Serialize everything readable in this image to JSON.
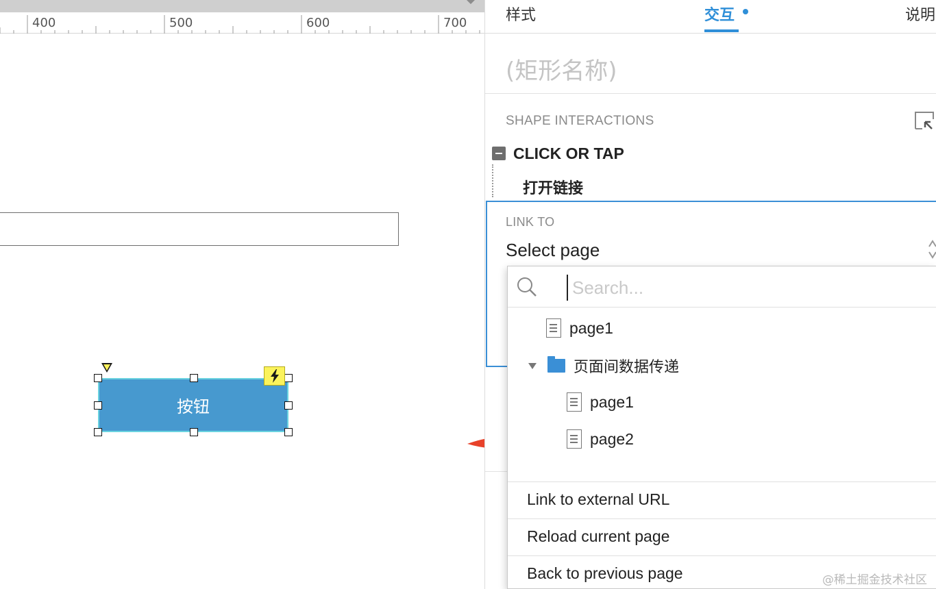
{
  "ruler": {
    "labels": [
      "400",
      "500",
      "600",
      "700"
    ]
  },
  "canvas": {
    "button_label": "按钮"
  },
  "panel": {
    "tabs": [
      {
        "label": "样式"
      },
      {
        "label": "交互"
      },
      {
        "label": "说明"
      }
    ],
    "active_tab": "交互",
    "shape_name_placeholder": "(矩形名称)",
    "section_title": "SHAPE INTERACTIONS",
    "event": {
      "title": "CLICK OR TAP",
      "action": "打开链接"
    },
    "link_to": {
      "label": "LINK TO",
      "value": "Select page"
    }
  },
  "dropdown": {
    "search_placeholder": "Search...",
    "tree": [
      {
        "label": "page1"
      },
      {
        "label": "页面间数据传递"
      },
      {
        "label": "page1"
      },
      {
        "label": "page2"
      }
    ],
    "actions": [
      {
        "label": "Link to external URL"
      },
      {
        "label": "Reload current page"
      },
      {
        "label": "Back to previous page"
      }
    ]
  },
  "colors": {
    "accent": "#2f8fd8",
    "button_fill": "#4799cf",
    "arrow": "#e8422a",
    "badge": "#fbf35c"
  },
  "watermark": "@稀土掘金技术社区"
}
